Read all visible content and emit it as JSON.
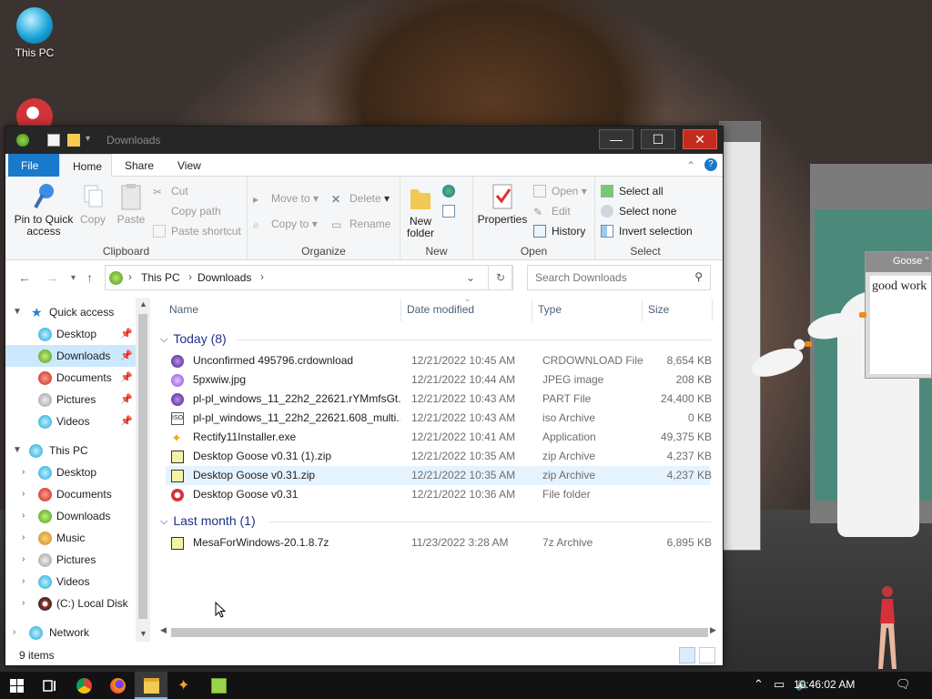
{
  "desktop": {
    "icons": [
      {
        "label": "This PC",
        "icon": "this-pc-icon"
      }
    ],
    "goose_dialog": {
      "title": "Goose \"",
      "note": "good work"
    }
  },
  "window": {
    "title": "Downloads",
    "controls": {
      "minimize": "—",
      "maximize": "☐",
      "close": "✕"
    }
  },
  "ribbon_tabs": [
    {
      "label": "File"
    },
    {
      "label": "Home"
    },
    {
      "label": "Share"
    },
    {
      "label": "View"
    }
  ],
  "ribbon": {
    "clipboard": {
      "label": "Clipboard",
      "pin": "Pin to Quick access",
      "copy": "Copy",
      "paste": "Paste",
      "cut": "Cut",
      "copy_path": "Copy path",
      "paste_shortcut": "Paste shortcut"
    },
    "organize": {
      "label": "Organize",
      "move_to": "Move to",
      "copy_to": "Copy to",
      "delete": "Delete",
      "rename": "Rename"
    },
    "new": {
      "label": "New",
      "new_folder": "New folder"
    },
    "open": {
      "label": "Open",
      "properties": "Properties",
      "open": "Open",
      "edit": "Edit",
      "history": "History"
    },
    "select": {
      "label": "Select",
      "select_all": "Select all",
      "select_none": "Select none",
      "invert": "Invert selection"
    }
  },
  "address": {
    "crumbs": [
      "This PC",
      "Downloads"
    ],
    "search_placeholder": "Search Downloads"
  },
  "nav": {
    "quick_access": "Quick access",
    "quick_items": [
      "Desktop",
      "Downloads",
      "Documents",
      "Pictures",
      "Videos"
    ],
    "this_pc": "This PC",
    "pc_items": [
      "Desktop",
      "Documents",
      "Downloads",
      "Music",
      "Pictures",
      "Videos",
      "(C:) Local Disk"
    ],
    "network": "Network"
  },
  "columns": {
    "name": "Name",
    "date": "Date modified",
    "type": "Type",
    "size": "Size"
  },
  "groups": [
    {
      "label": "Today (8)",
      "files": [
        {
          "name": "Unconfirmed 495796.crdownload",
          "date": "12/21/2022 10:45 AM",
          "type": "CRDOWNLOAD File",
          "size": "8,654 KB",
          "icon": "tor-file-icon"
        },
        {
          "name": "5pxwiw.jpg",
          "date": "12/21/2022 10:44 AM",
          "type": "JPEG image",
          "size": "208 KB",
          "icon": "image-file-icon"
        },
        {
          "name": "pl-pl_windows_11_22h2_22621.rYMmfsGt...",
          "date": "12/21/2022 10:43 AM",
          "type": "PART File",
          "size": "24,400 KB",
          "icon": "tor-file-icon"
        },
        {
          "name": "pl-pl_windows_11_22h2_22621.608_multi...",
          "date": "12/21/2022 10:43 AM",
          "type": "iso Archive",
          "size": "0 KB",
          "icon": "iso-file-icon"
        },
        {
          "name": "Rectify11Installer.exe",
          "date": "12/21/2022 10:41 AM",
          "type": "Application",
          "size": "49,375 KB",
          "icon": "exe-file-icon"
        },
        {
          "name": "Desktop Goose v0.31 (1).zip",
          "date": "12/21/2022 10:35 AM",
          "type": "zip Archive",
          "size": "4,237 KB",
          "icon": "zip-file-icon"
        },
        {
          "name": "Desktop Goose v0.31.zip",
          "date": "12/21/2022 10:35 AM",
          "type": "zip Archive",
          "size": "4,237 KB",
          "icon": "zip-file-icon"
        },
        {
          "name": "Desktop Goose v0.31",
          "date": "12/21/2022 10:36 AM",
          "type": "File folder",
          "size": "",
          "icon": "folder-icon"
        }
      ]
    },
    {
      "label": "Last month (1)",
      "files": [
        {
          "name": "MesaForWindows-20.1.8.7z",
          "date": "11/23/2022 3:28 AM",
          "type": "7z Archive",
          "size": "6,895 KB",
          "icon": "zip-file-icon"
        }
      ]
    }
  ],
  "status": {
    "items": "9 items"
  },
  "taskbar": {
    "clock": "10:46:02 AM"
  },
  "colors": {
    "accent": "#1979ca",
    "selection": "#cce8ff",
    "hover": "#e5f3ff",
    "close": "#c42b1c"
  }
}
